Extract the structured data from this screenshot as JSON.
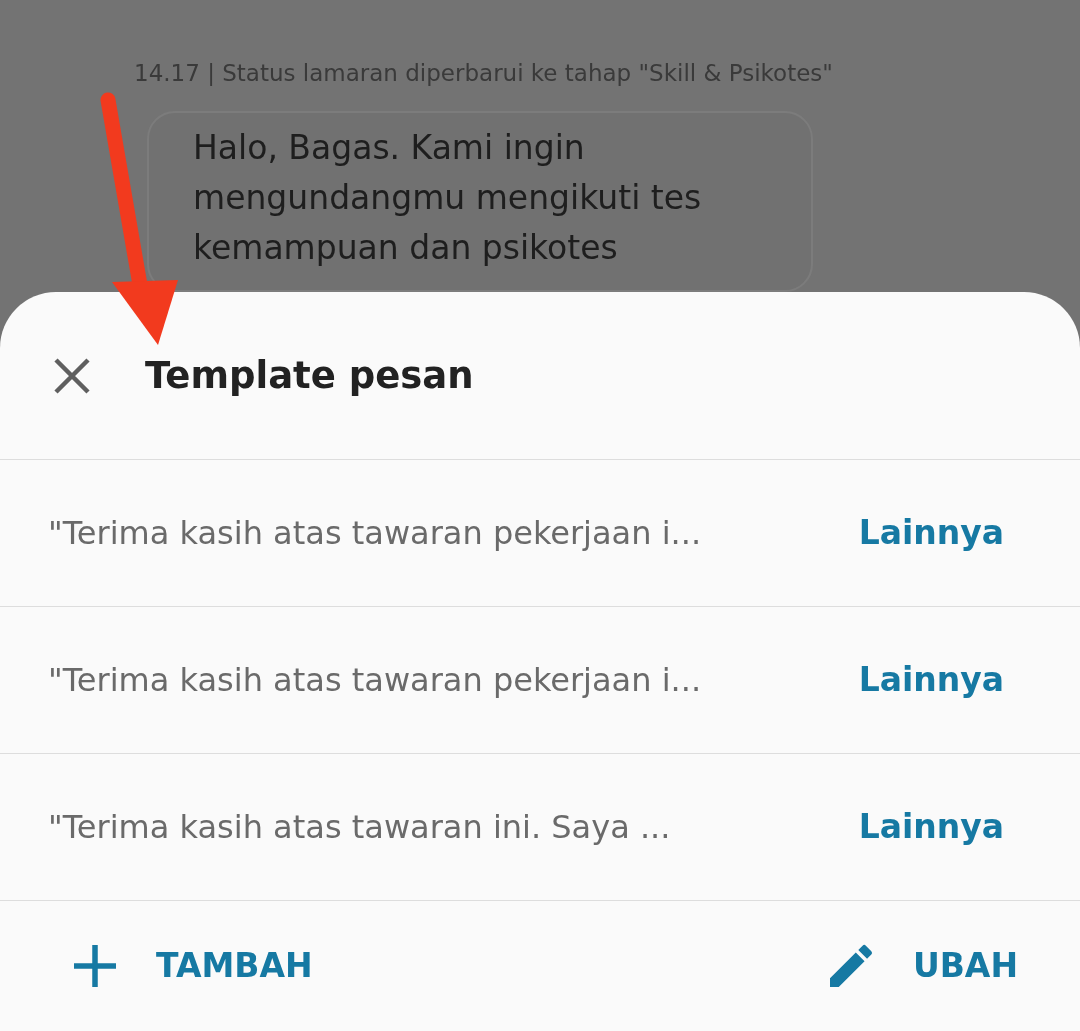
{
  "chat": {
    "status_line": "14.17 | Status lamaran diperbarui ke tahap \"Skill & Psikotes\"",
    "message_lines": [
      "Halo, Bagas. Kami ingin",
      "mengundangmu mengikuti tes",
      "kemampuan dan psikotes"
    ]
  },
  "sheet": {
    "title": "Template pesan",
    "templates": [
      {
        "text": "\"Terima kasih atas tawaran pekerjaan i...",
        "action": "Lainnya"
      },
      {
        "text": "\"Terima kasih atas tawaran pekerjaan i...",
        "action": "Lainnya"
      },
      {
        "text": "\"Terima kasih atas tawaran ini. Saya ...",
        "action": "Lainnya"
      }
    ],
    "footer": {
      "add": "TAMBAH",
      "edit": "UBAH"
    }
  }
}
